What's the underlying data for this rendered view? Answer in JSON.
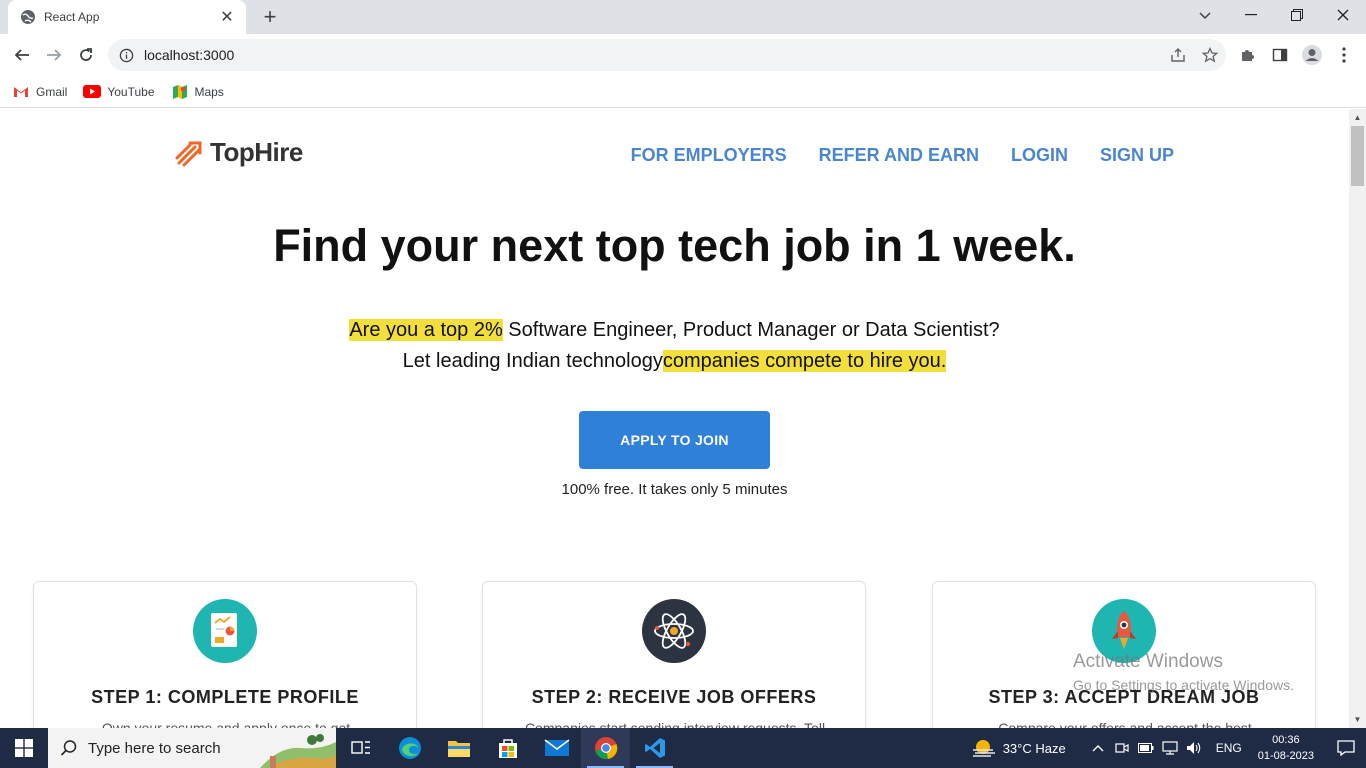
{
  "browser": {
    "tab_title": "React App",
    "url": "localhost:3000",
    "bookmarks": [
      {
        "label": "Gmail",
        "icon": "gmail-icon"
      },
      {
        "label": "YouTube",
        "icon": "youtube-icon"
      },
      {
        "label": "Maps",
        "icon": "maps-icon"
      }
    ]
  },
  "page": {
    "logo_text": "TopHire",
    "nav": [
      "FOR EMPLOYERS",
      "REFER AND EARN",
      "LOGIN",
      "SIGN UP"
    ],
    "headline": "Find your next top tech job in 1 week.",
    "sub1_highlight": "Are you a top 2%",
    "sub1_rest": " Software Engineer, Product Manager or Data Scientist?",
    "sub2_rest": "Let leading Indian technology",
    "sub2_highlight": "companies compete to hire you.",
    "cta_label": "APPLY TO JOIN",
    "cta_note": "100% free. It takes only 5 minutes",
    "steps": [
      {
        "title": "STEP 1: COMPLETE PROFILE",
        "icon": "profile-document-icon",
        "color": "#1fb5b0",
        "text": "Own your resume and apply once to get"
      },
      {
        "title": "STEP 2: RECEIVE JOB OFFERS",
        "icon": "atom-icon",
        "color": "#2d3441",
        "text": "Companies start sending interview requests. Tell"
      },
      {
        "title": "STEP 3: ACCEPT DREAM JOB",
        "icon": "rocket-icon",
        "color": "#1fb5b0",
        "text": "Compare your offers and accept the best"
      }
    ],
    "accent": "#2f80d9",
    "highlight_color": "#f2df3c"
  },
  "watermark": {
    "line1": "Activate Windows",
    "line2": "Go to Settings to activate Windows."
  },
  "taskbar": {
    "search_placeholder": "Type here to search",
    "weather": "33°C  Haze",
    "language": "ENG",
    "time": "00:36",
    "date": "01-08-2023"
  }
}
